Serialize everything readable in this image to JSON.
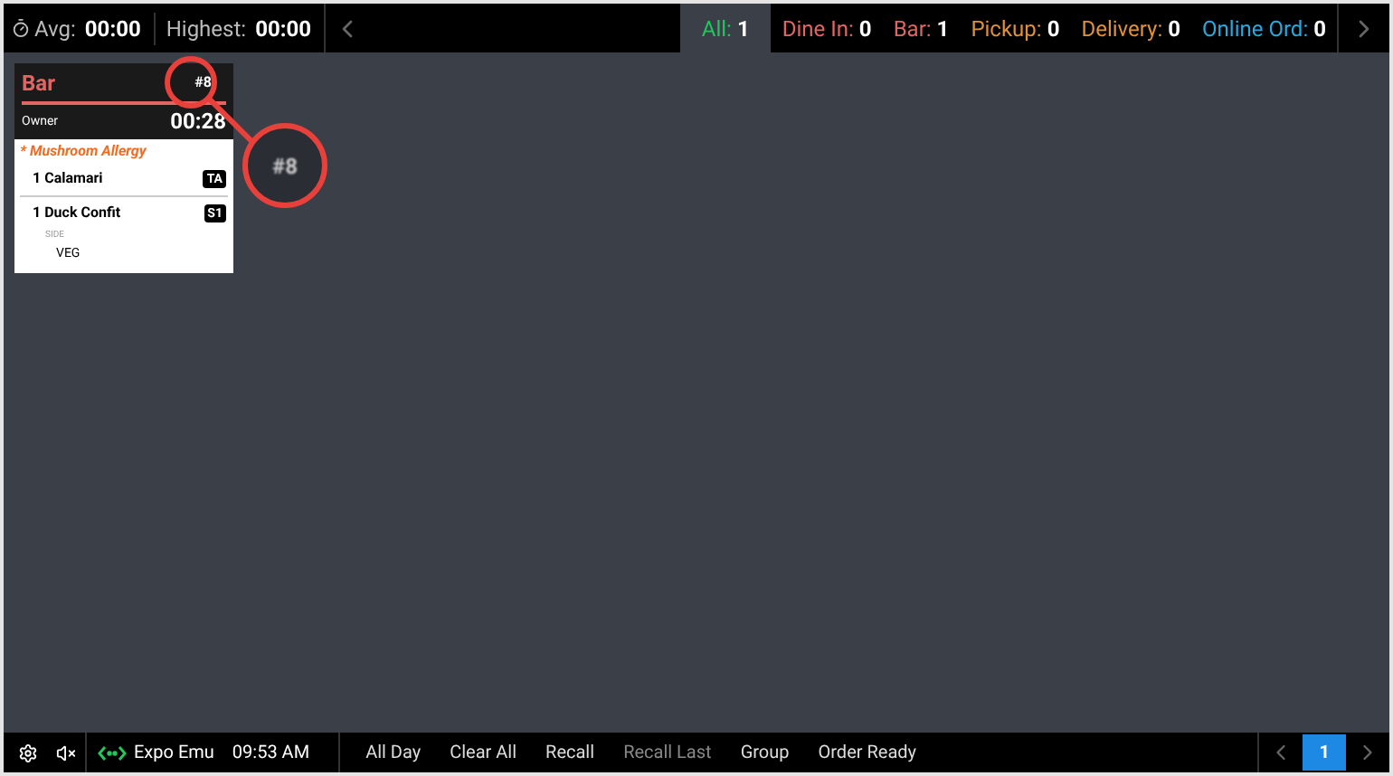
{
  "stats": [
    {
      "label": "Avg:",
      "value": "00:00"
    },
    {
      "label": "Highest:",
      "value": "00:00"
    }
  ],
  "filters": [
    {
      "label": "All:",
      "count": "1",
      "color": "#22c55e",
      "selected": true
    },
    {
      "label": "Dine In:",
      "count": "0",
      "color": "#e06666",
      "selected": false
    },
    {
      "label": "Bar:",
      "count": "1",
      "color": "#e06666",
      "selected": false
    },
    {
      "label": "Pickup:",
      "count": "0",
      "color": "#e0903a",
      "selected": false
    },
    {
      "label": "Delivery:",
      "count": "0",
      "color": "#e0903a",
      "selected": false
    },
    {
      "label": "Online Ord:",
      "count": "0",
      "color": "#29a8e0",
      "selected": false
    }
  ],
  "tickets": [
    {
      "title": "Bar",
      "number": "#8",
      "owner": "Owner",
      "timer": "00:28",
      "note": "* Mushroom Allergy",
      "items": [
        {
          "qty": "1",
          "name": "Calamari",
          "tag": "TA"
        },
        {
          "qty": "1",
          "name": "Duck Confit",
          "tag": "S1",
          "modifiers": [
            {
              "group": "SIDE",
              "value": "VEG"
            }
          ]
        }
      ]
    }
  ],
  "callout": {
    "text": "#8"
  },
  "status_bar": {
    "station": "Expo Emu",
    "time": "09:53 AM",
    "actions": [
      {
        "label": "All Day",
        "disabled": false
      },
      {
        "label": "Clear All",
        "disabled": false
      },
      {
        "label": "Recall",
        "disabled": false
      },
      {
        "label": "Recall Last",
        "disabled": true
      },
      {
        "label": "Group",
        "disabled": false
      },
      {
        "label": "Order Ready",
        "disabled": false
      }
    ],
    "page": "1"
  }
}
